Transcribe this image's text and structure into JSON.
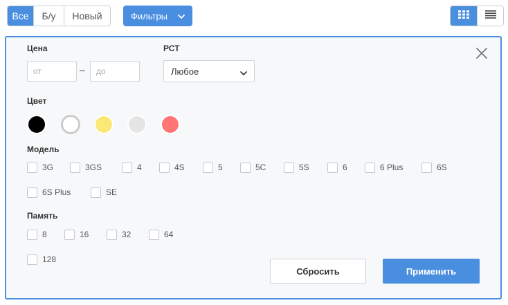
{
  "condition_tabs": [
    {
      "label": "Все",
      "active": true
    },
    {
      "label": "Б/у",
      "active": false
    },
    {
      "label": "Новый",
      "active": false
    }
  ],
  "filters_button": {
    "label": "Фильтры",
    "icon": "chevron-down-icon"
  },
  "view_toggle": [
    {
      "icon": "grid-view-icon",
      "active": true
    },
    {
      "icon": "list-view-icon",
      "active": false
    }
  ],
  "panel": {
    "close_icon": "close-icon",
    "price": {
      "label": "Цена",
      "from_placeholder": "от",
      "to_placeholder": "до",
      "separator": "–"
    },
    "rst": {
      "label": "РСТ",
      "selected": "Любое"
    },
    "color": {
      "label": "Цвет",
      "swatches": [
        {
          "name": "black",
          "fill": "#000000",
          "border": "#ffffff"
        },
        {
          "name": "white",
          "fill": "#ffffff",
          "border": "#cccccc"
        },
        {
          "name": "yellow",
          "fill": "#fce877",
          "border": "#ffffff"
        },
        {
          "name": "gray",
          "fill": "#e5e5e5",
          "border": "#ffffff"
        },
        {
          "name": "red",
          "fill": "#ff7474",
          "border": "#ffffff"
        }
      ]
    },
    "model": {
      "label": "Модель",
      "options": [
        "3G",
        "3GS",
        "4",
        "4S",
        "5",
        "5C",
        "5S",
        "6",
        "6 Plus",
        "6S",
        "6S Plus",
        "SE"
      ]
    },
    "memory": {
      "label": "Память",
      "options": [
        "8",
        "16",
        "32",
        "64",
        "128"
      ]
    },
    "reset_label": "Сбросить",
    "apply_label": "Применить"
  },
  "colors": {
    "accent": "#4a8ee0",
    "panel_bg": "#f7f8fa"
  }
}
